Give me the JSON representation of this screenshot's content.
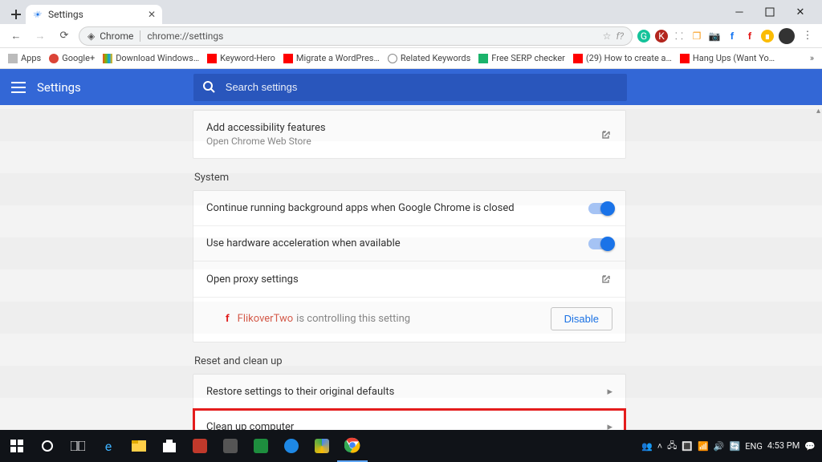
{
  "browser": {
    "tab_title": "Settings",
    "urlchip": "Chrome",
    "url": "chrome://settings",
    "star": "☆",
    "f_question": "f?",
    "bookmarks": [
      {
        "label": "Apps",
        "color": "#bbb"
      },
      {
        "label": "Google+",
        "color": "#db4437"
      },
      {
        "label": "Download Windows…",
        "color": "#ffb900"
      },
      {
        "label": "Keyword-Hero",
        "color": "#ff0000"
      },
      {
        "label": "Migrate a WordPres…",
        "color": "#ff0000"
      },
      {
        "label": "Related Keywords",
        "color": "#888"
      },
      {
        "label": "Free SERP checker ",
        "color": "#1bb36b"
      },
      {
        "label": "(29) How to create a…",
        "color": "#ff0000"
      },
      {
        "label": "Hang Ups (Want Yo…",
        "color": "#ff0000"
      }
    ]
  },
  "settings": {
    "header": "Settings",
    "search_ph": "Search settings",
    "access": {
      "title": "Add accessibility features",
      "sub": "Open Chrome Web Store"
    },
    "system_title": "System",
    "sys_bg": "Continue running background apps when Google Chrome is closed",
    "sys_hw": "Use hardware acceleration when available",
    "sys_proxy": "Open proxy settings",
    "proxy_ext_name": "FlikoverTwo",
    "proxy_ext_note": " is controlling this setting",
    "disable": "Disable",
    "reset_title": "Reset and clean up",
    "restore": "Restore settings to their original defaults",
    "cleanup": "Clean up computer"
  },
  "taskbar": {
    "lang": "ENG",
    "time": "4:53 PM"
  }
}
